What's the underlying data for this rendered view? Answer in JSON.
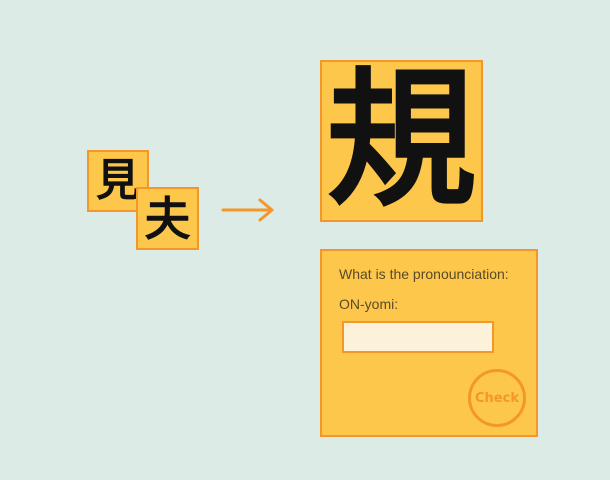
{
  "tiles": {
    "component_a": "見",
    "component_b": "夫",
    "result": "規"
  },
  "quiz": {
    "prompt": "What is the pronounciation:",
    "field_label": "ON-yomi:",
    "answer_value": "",
    "check_label": "Check"
  },
  "icons": {
    "arrow": "right-arrow-icon"
  },
  "colors": {
    "background": "#dcebe6",
    "tile_fill": "#fcc74a",
    "accent_orange": "#f3972a",
    "input_fill": "#fcf1d9"
  }
}
